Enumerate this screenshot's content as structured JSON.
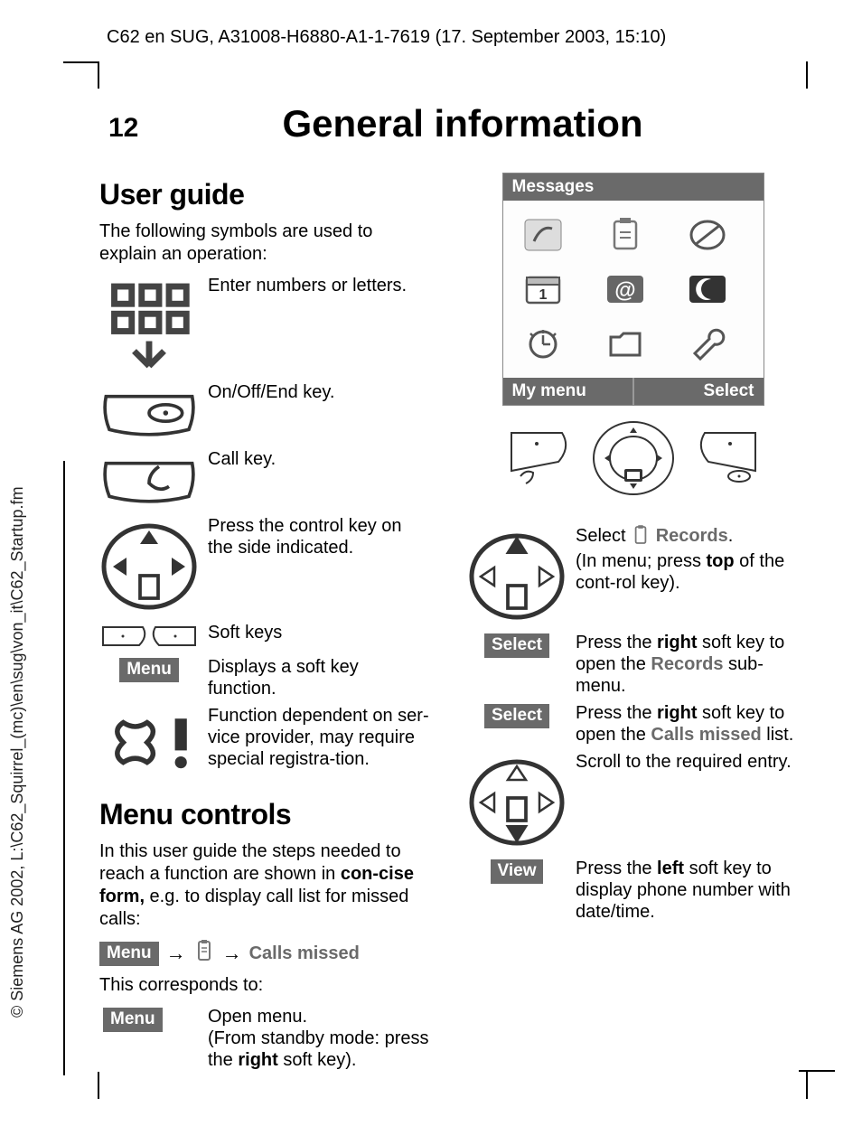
{
  "header": "C62 en SUG, A31008-H6880-A1-1-7619 (17. September 2003, 15:10)",
  "sideline": "© Siemens AG 2002, L:\\C62_Squirrel_(mc)\\en\\sug\\von_it\\C62_Startup.fm",
  "page_number": "12",
  "page_title": "General information",
  "left": {
    "h_user_guide": "User guide",
    "intro1": "The following symbols are used to explain an operation:",
    "defs": {
      "numbers": "Enter numbers or letters.",
      "onoff": "On/Off/End key.",
      "call": "Call key.",
      "control": "Press the control key on the side indicated.",
      "softkeys": "Soft keys",
      "menu_label": "Menu",
      "menu_desc": "Displays a soft key function.",
      "provider": "Function dependent on ser-vice provider, may require special registra-tion."
    },
    "h_menu_controls": "Menu controls",
    "intro2_a": "In this user guide the steps needed to reach a function are shown in ",
    "intro2_b": "con-cise form,",
    "intro2_c": " e.g. to display call list for missed calls:",
    "path_menu": "Menu",
    "path_calls_missed": "Calls missed",
    "corresponds": "This corresponds to:",
    "open_menu_label": "Menu",
    "open_menu_a": "Open menu.",
    "open_menu_b": "(From standby mode: press the ",
    "open_menu_c": "right",
    "open_menu_d": " soft key)."
  },
  "right": {
    "screen_title": "Messages",
    "soft_left": "My menu",
    "soft_right": "Select",
    "r1_a": "Select ",
    "r1_b": "Records",
    "r1_c": ".",
    "r1_d": "(In menu; press ",
    "r1_e": "top",
    "r1_f": " of the cont-rol key).",
    "select_label": "Select",
    "r2_a": "Press the ",
    "r2_b": "right",
    "r2_c": " soft key to open the ",
    "r2_d": "Records",
    "r2_e": " sub-menu.",
    "r3_a": "Press the ",
    "r3_b": "right",
    "r3_c": " soft key to open the ",
    "r3_d": "Calls missed",
    "r3_e": " list.",
    "r4": "Scroll to the required entry.",
    "view_label": "View",
    "r5_a": "Press the ",
    "r5_b": "left",
    "r5_c": " soft key to display phone number with date/time."
  }
}
